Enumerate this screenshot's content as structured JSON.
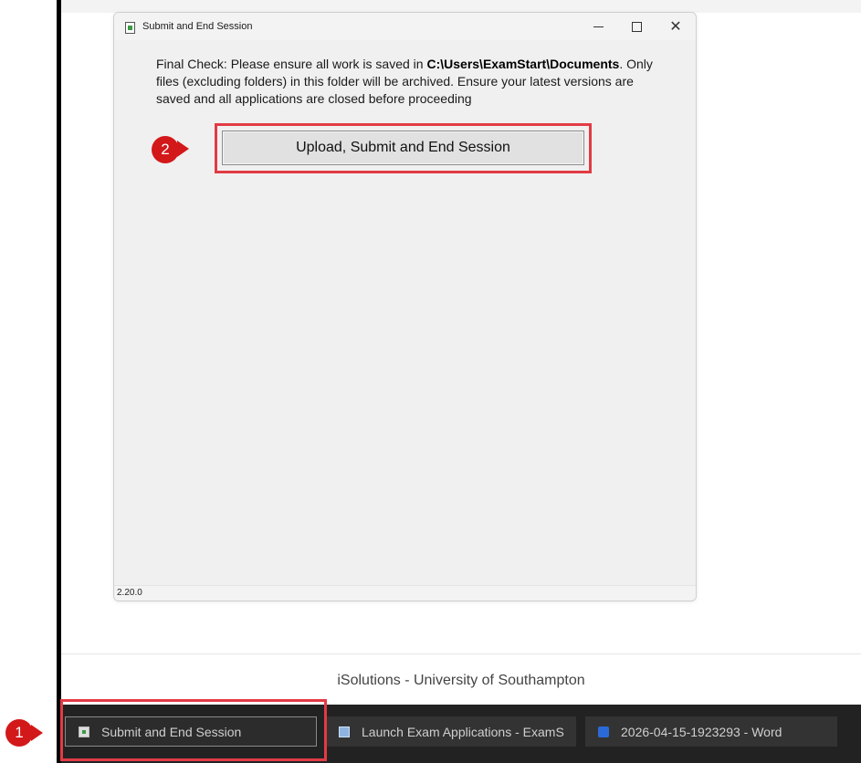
{
  "window": {
    "title": "Submit and End Session",
    "message_part1": "Final Check: Please ensure all work is saved in ",
    "message_path": "C:\\Users\\ExamStart\\Documents",
    "message_part2": ". Only files (excluding folders) in this folder will be archived. Ensure your latest versions are saved and all applications are closed before proceeding",
    "button_label": "Upload, Submit and End Session",
    "version": "2.20.0"
  },
  "callouts": {
    "step1": "1",
    "step2": "2"
  },
  "footer": {
    "text": "iSolutions - University of Southampton"
  },
  "taskbar": {
    "items": [
      {
        "label": "Submit and End Session",
        "icon": "submit-app-icon"
      },
      {
        "label": "Launch Exam Applications - ExamS",
        "icon": "launch-app-icon"
      },
      {
        "label": "2026-04-15-1923293 - Word",
        "icon": "word-icon"
      }
    ]
  },
  "colors": {
    "highlight": "#e23b45",
    "callout": "#d3181a",
    "taskbar": "#222222"
  }
}
